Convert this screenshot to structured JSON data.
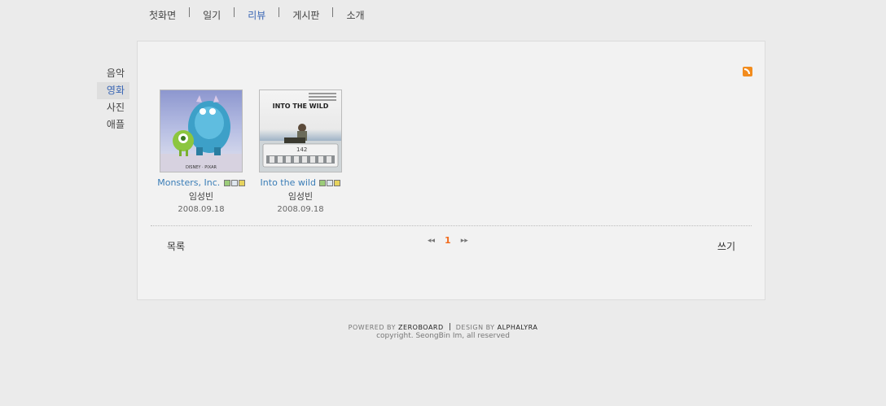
{
  "topnav": {
    "items": [
      "첫화면",
      "일기",
      "리뷰",
      "게시판",
      "소개"
    ]
  },
  "sidenav": {
    "items": [
      "음악",
      "영화",
      "사진",
      "애플"
    ]
  },
  "posts": [
    {
      "title": "Monsters, Inc.",
      "author": "임성빈",
      "date": "2008.09.18",
      "poster_brand": "DISNEY · PIXAR"
    },
    {
      "title": "Into the wild",
      "author": "임성빈",
      "date": "2008.09.18",
      "poster_title": "INTO THE WILD",
      "poster_bus_number": "142"
    }
  ],
  "actions": {
    "list_label": "목록",
    "write_label": "쓰기"
  },
  "pager": {
    "prev": "◂◂",
    "current": "1",
    "next": "▸▸"
  },
  "footer": {
    "powered_prefix": "POWERED BY",
    "powered_name": "ZEROBOARD",
    "design_prefix": "DESIGN BY",
    "design_name": "ALPHALYRA",
    "copyright": "copyright. SeongBin Im, all reserved"
  },
  "colors": {
    "accent_link": "#3a7db7",
    "active_nav": "#3a66b4",
    "page_number": "#f26c1e",
    "rss": "#f28c1e"
  }
}
